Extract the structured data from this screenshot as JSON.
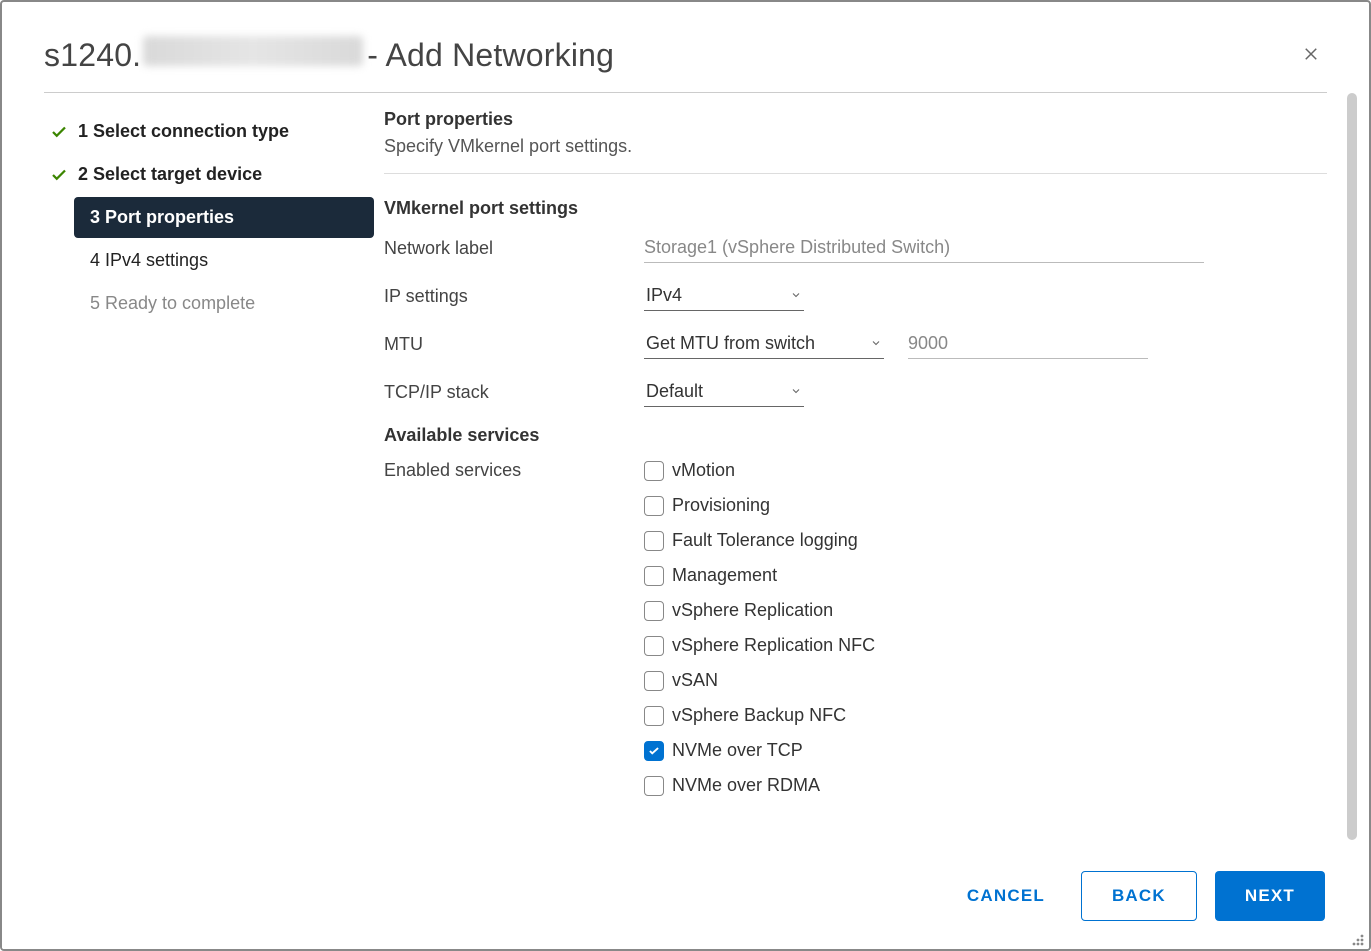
{
  "header": {
    "host_prefix": "s1240.",
    "title_suffix": " - Add Networking"
  },
  "steps": [
    {
      "label": "1 Select connection type",
      "state": "completed"
    },
    {
      "label": "2 Select target device",
      "state": "completed"
    },
    {
      "label": "3 Port properties",
      "state": "active"
    },
    {
      "label": "4 IPv4 settings",
      "state": "pending"
    },
    {
      "label": "5 Ready to complete",
      "state": "future"
    }
  ],
  "content": {
    "title": "Port properties",
    "subtitle": "Specify VMkernel port settings.",
    "vmkernel_heading": "VMkernel port settings",
    "network_label_lbl": "Network label",
    "network_label_val": "Storage1 (vSphere Distributed Switch)",
    "ip_settings_lbl": "IP settings",
    "ip_settings_val": "IPv4",
    "mtu_lbl": "MTU",
    "mtu_mode": "Get MTU from switch",
    "mtu_value": "9000",
    "tcpip_lbl": "TCP/IP stack",
    "tcpip_val": "Default",
    "avail_heading": "Available services",
    "enabled_lbl": "Enabled services",
    "services": [
      {
        "label": "vMotion",
        "checked": false
      },
      {
        "label": "Provisioning",
        "checked": false
      },
      {
        "label": "Fault Tolerance logging",
        "checked": false
      },
      {
        "label": "Management",
        "checked": false
      },
      {
        "label": "vSphere Replication",
        "checked": false
      },
      {
        "label": "vSphere Replication NFC",
        "checked": false
      },
      {
        "label": "vSAN",
        "checked": false
      },
      {
        "label": "vSphere Backup NFC",
        "checked": false
      },
      {
        "label": "NVMe over TCP",
        "checked": true
      },
      {
        "label": "NVMe over RDMA",
        "checked": false
      }
    ]
  },
  "footer": {
    "cancel": "CANCEL",
    "back": "BACK",
    "next": "NEXT"
  }
}
